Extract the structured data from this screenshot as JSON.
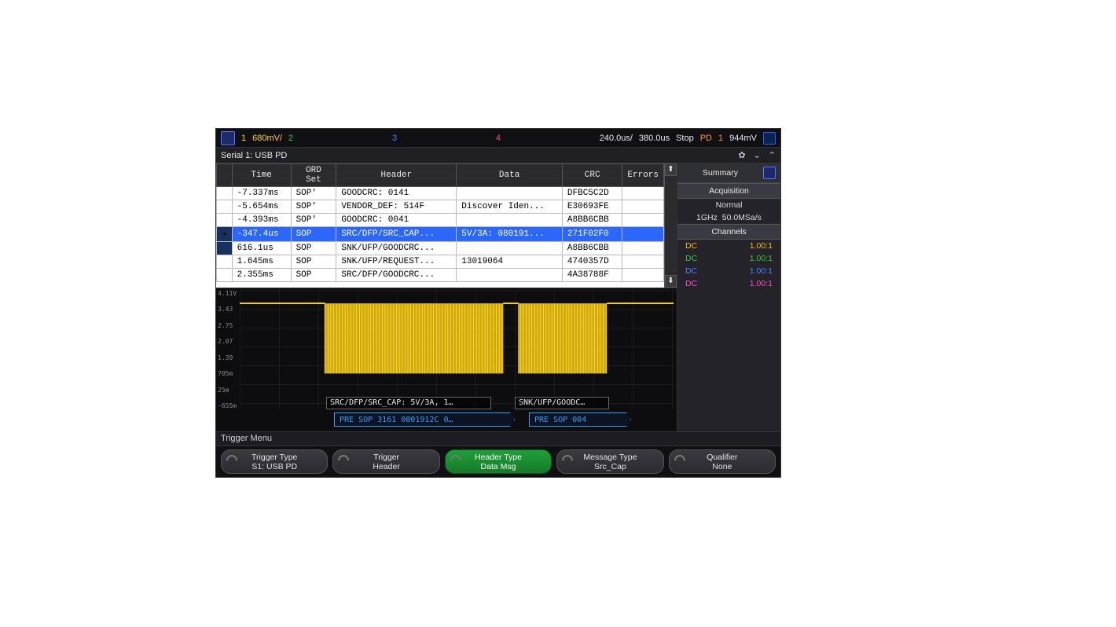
{
  "topbar": {
    "ch1": "1",
    "ch1_val": "680mV/",
    "ch2": "2",
    "ch3": "3",
    "ch4": "4",
    "timebase": "240.0us/",
    "delay": "380.0us",
    "status": "Stop",
    "pd_lbl": "PD",
    "pd_num": "1",
    "pd_val": "944mV"
  },
  "titlebar": {
    "title": "Serial 1: USB PD",
    "summary": "Summary"
  },
  "table": {
    "headers": [
      "",
      "Time",
      "ORD Set",
      "Header",
      "Data",
      "CRC",
      "Errors"
    ],
    "rows": [
      {
        "time": "-7.337ms",
        "ord": "SOP'",
        "hdr": "GOODCRC: 0141",
        "data": "",
        "crc": "DFBC5C2D",
        "err": ""
      },
      {
        "time": "-5.654ms",
        "ord": "SOP'",
        "hdr": "VENDOR_DEF: 514F",
        "data": "Discover Iden...",
        "crc": "E30693FE",
        "err": ""
      },
      {
        "time": "-4.393ms",
        "ord": "SOP'",
        "hdr": "GOODCRC: 0041",
        "data": "",
        "crc": "A8BB6CBB",
        "err": ""
      },
      {
        "time": "-347.4us",
        "ord": "SOP",
        "hdr": "SRC/DFP/SRC_CAP...",
        "data": "5V/3A: 080191...",
        "crc": "271F02F0",
        "err": "",
        "sel": true
      },
      {
        "time": "616.1us",
        "ord": "SOP",
        "hdr": "SNK/UFP/GOODCRC...",
        "data": "",
        "crc": "A8BB6CBB",
        "err": "",
        "blue": true
      },
      {
        "time": "1.645ms",
        "ord": "SOP",
        "hdr": "SNK/UFP/REQUEST...",
        "data": "13019064",
        "crc": "4740357D",
        "err": ""
      },
      {
        "time": "2.355ms",
        "ord": "SOP",
        "hdr": "SRC/DFP/GOODCRC...",
        "data": "",
        "crc": "4A38788F",
        "err": ""
      }
    ]
  },
  "waveform": {
    "yticks": [
      "4.11V",
      "3.43",
      "2.75",
      "2.07",
      "1.39",
      "705m",
      "25m",
      "-655m"
    ],
    "overlay1": "SRC/DFP/SRC_CAP: 5V/3A, 1…",
    "overlay2": "SNK/UFP/GOODC…",
    "packet1": "PRE  SOP  3161  0801912C  0…",
    "packet2": "PRE  SOP  004"
  },
  "side": {
    "summary": "Summary",
    "acq_title": "Acquisition",
    "acq_mode": "Normal",
    "acq_bw": "1GHz",
    "acq_rate": "50.0MSa/s",
    "ch_title": "Channels",
    "rows": [
      {
        "lbl": "DC",
        "val": "1.00:1",
        "cls": ""
      },
      {
        "lbl": "DC",
        "val": "1.00:1",
        "cls": "g"
      },
      {
        "lbl": "DC",
        "val": "1.00:1",
        "cls": "b"
      },
      {
        "lbl": "DC",
        "val": "1.00:1",
        "cls": "m"
      }
    ]
  },
  "trigger": {
    "menu_title": "Trigger Menu",
    "buttons": [
      {
        "l1": "Trigger Type",
        "l2": "S1: USB PD",
        "active": false
      },
      {
        "l1": "Trigger",
        "l2": "Header",
        "active": false
      },
      {
        "l1": "Header Type",
        "l2": "Data Msg",
        "active": true
      },
      {
        "l1": "Message Type",
        "l2": "Src_Cap",
        "active": false
      },
      {
        "l1": "Qualifier",
        "l2": "None",
        "active": false
      }
    ]
  }
}
